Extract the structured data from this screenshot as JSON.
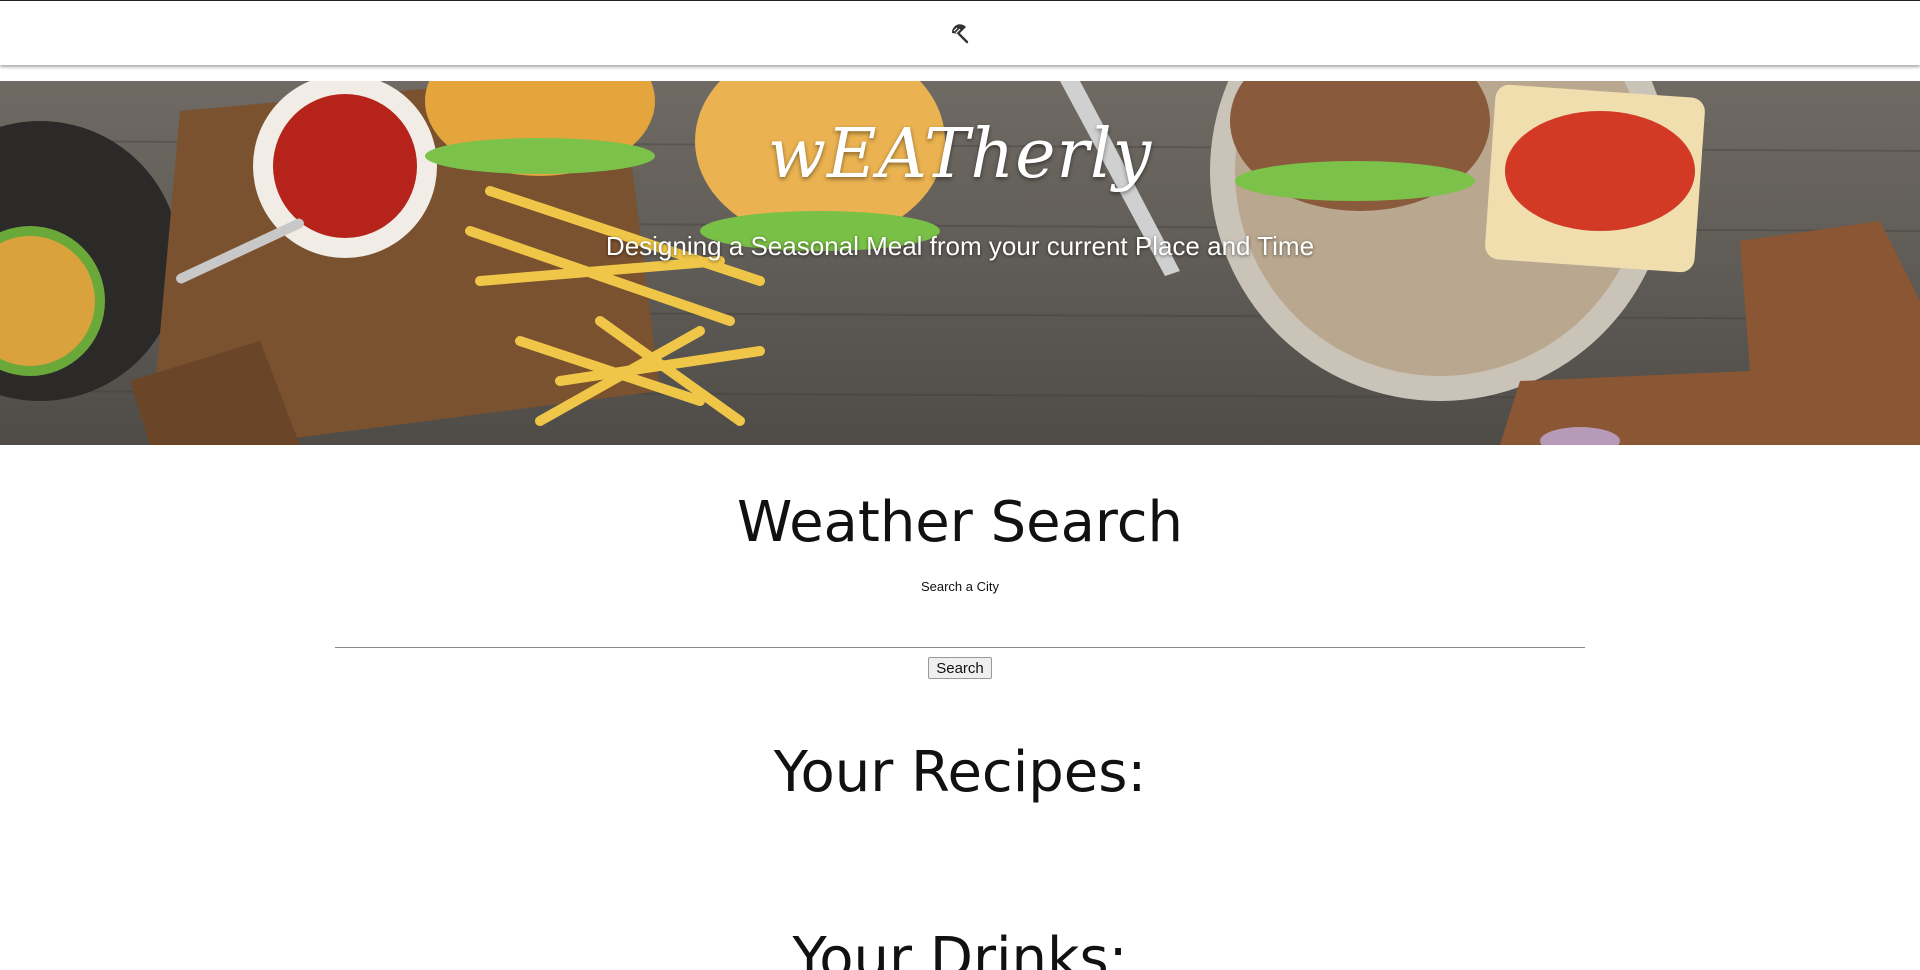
{
  "header": {
    "logo_icon": "umbrella-icon"
  },
  "hero": {
    "title": "wEATherly",
    "subtitle": "Designing a Seasonal Meal from your current Place and Time"
  },
  "weather": {
    "title": "Weather Search",
    "label": "Search a City",
    "input_value": "",
    "button_label": "Search"
  },
  "recipes": {
    "title": "Your Recipes:"
  },
  "drinks": {
    "title": "Your Drinks:"
  }
}
